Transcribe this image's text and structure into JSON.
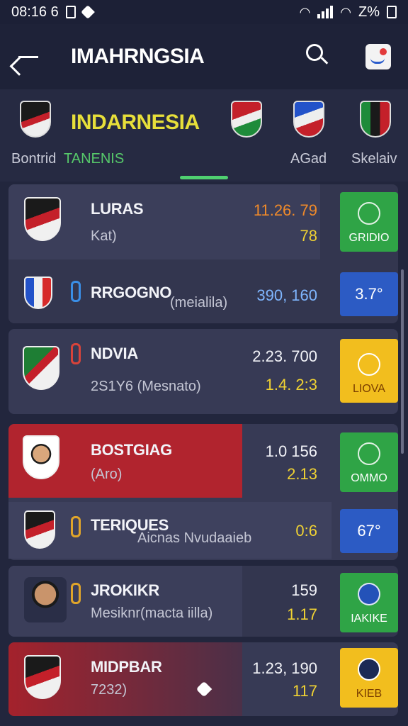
{
  "status": {
    "time": "08:16 6",
    "battery": "Z%"
  },
  "header": {
    "title": "IMAHRNGSIA"
  },
  "team": {
    "name": "INDARNESIA",
    "tabs": [
      "Bontrid",
      "TANENIS",
      "AGad",
      "Skelaiv"
    ],
    "active_tab": 1
  },
  "matches": [
    {
      "name": "LURAS",
      "sub": "Kat)",
      "odd1": "11.26. 79",
      "odd2": "78",
      "badge_label": "GRIDIO",
      "badge_color": "green"
    },
    {
      "name": "RRGOGNO",
      "sub": "(meialila)",
      "odd1": "390, 160",
      "odd2": "",
      "badge_label": "3.7°",
      "badge_color": "blue"
    },
    {
      "name": "NDVIA",
      "sub": "2S1Y6 (Mesnato)",
      "odd1": "2.23. 700",
      "odd2": "1.4. 2:3",
      "badge_label": "LIOVA",
      "badge_color": "yellow"
    },
    {
      "name": "BOSTGIAG",
      "sub": "(Aro)",
      "odd1": "1.0 156",
      "odd2": "2.13",
      "badge_label": "OMMO",
      "badge_color": "green"
    },
    {
      "name": "TERIQUES",
      "sub": "Aicnas Nvudaaieb",
      "odd1": "0:6",
      "odd2": "",
      "badge_label": "67°",
      "badge_color": "blue"
    },
    {
      "name": "JROKIKR",
      "sub": "Mesiknr(macta iilla)",
      "odd1": "159",
      "odd2": "1.17",
      "badge_label": "IAKIKE",
      "badge_color": "green"
    },
    {
      "name": "MIDPBAR",
      "sub": "7232)",
      "odd1": "1.23, 190",
      "odd2": "117",
      "badge_label": "KIEB",
      "badge_color": "yellow"
    }
  ],
  "colors": {
    "accent_green": "#4fd070",
    "team_yellow": "#e7df3a",
    "bg": "#22263d"
  }
}
